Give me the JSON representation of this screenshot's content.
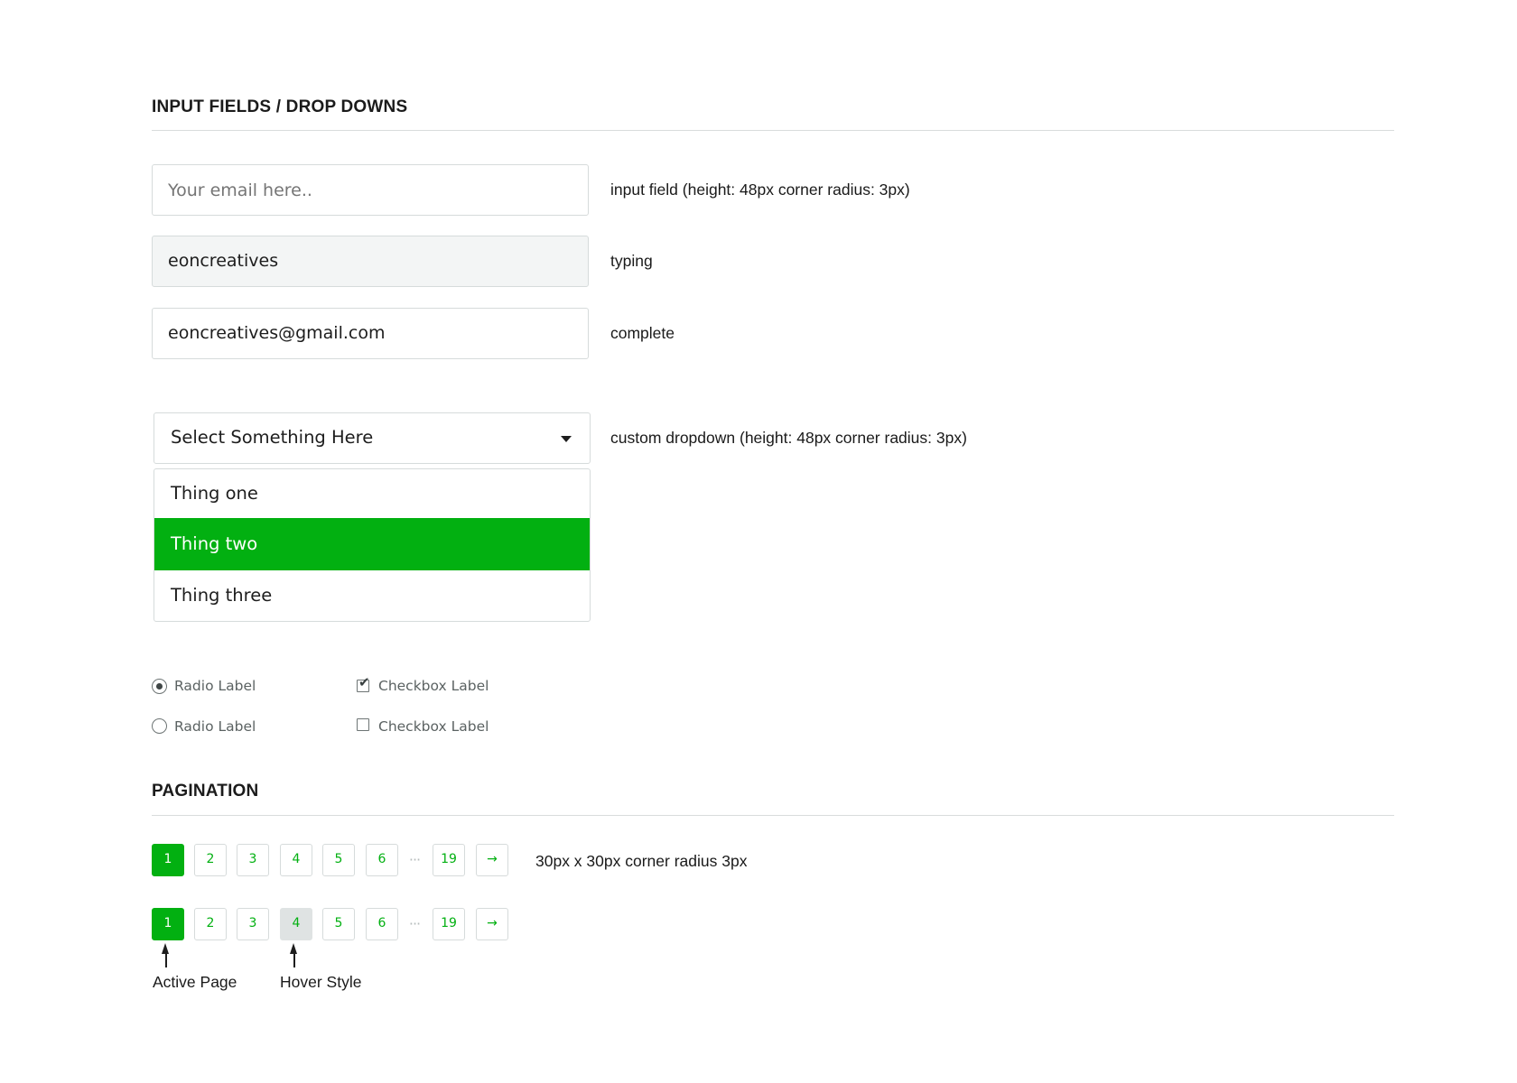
{
  "inputs_section": {
    "title": "INPUT FIELDS / DROP DOWNS"
  },
  "input_field": {
    "placeholder": "Your email here..",
    "note": "input field (height: 48px corner radius: 3px)"
  },
  "typing_field": {
    "value": "eoncreatives",
    "note": "typing"
  },
  "complete_field": {
    "value": "eoncreatives@gmail.com",
    "note": "complete"
  },
  "dropdown": {
    "selected": "Select Something Here",
    "note": "custom dropdown (height: 48px corner radius: 3px)",
    "options": [
      "Thing one",
      "Thing two",
      "Thing three"
    ],
    "active_option": "Thing two",
    "accent_color": "#02b011"
  },
  "radios": [
    {
      "label": "Radio Label",
      "checked": true
    },
    {
      "label": "Radio Label",
      "checked": false
    }
  ],
  "checkboxes": [
    {
      "label": "Checkbox Label",
      "checked": true
    },
    {
      "label": "Checkbox Label",
      "checked": false
    }
  ],
  "pagination_section": {
    "title": "PAGINATION"
  },
  "pagination": {
    "pages": [
      "1",
      "2",
      "3",
      "4",
      "5",
      "6"
    ],
    "ellipsis": "···",
    "last_page": "19",
    "next_arrow": "→",
    "active_page": "1",
    "hover_page": "4",
    "note": "30px  x 30px corner radius 3px",
    "active_label": "Active Page",
    "hover_label": "Hover Style"
  }
}
